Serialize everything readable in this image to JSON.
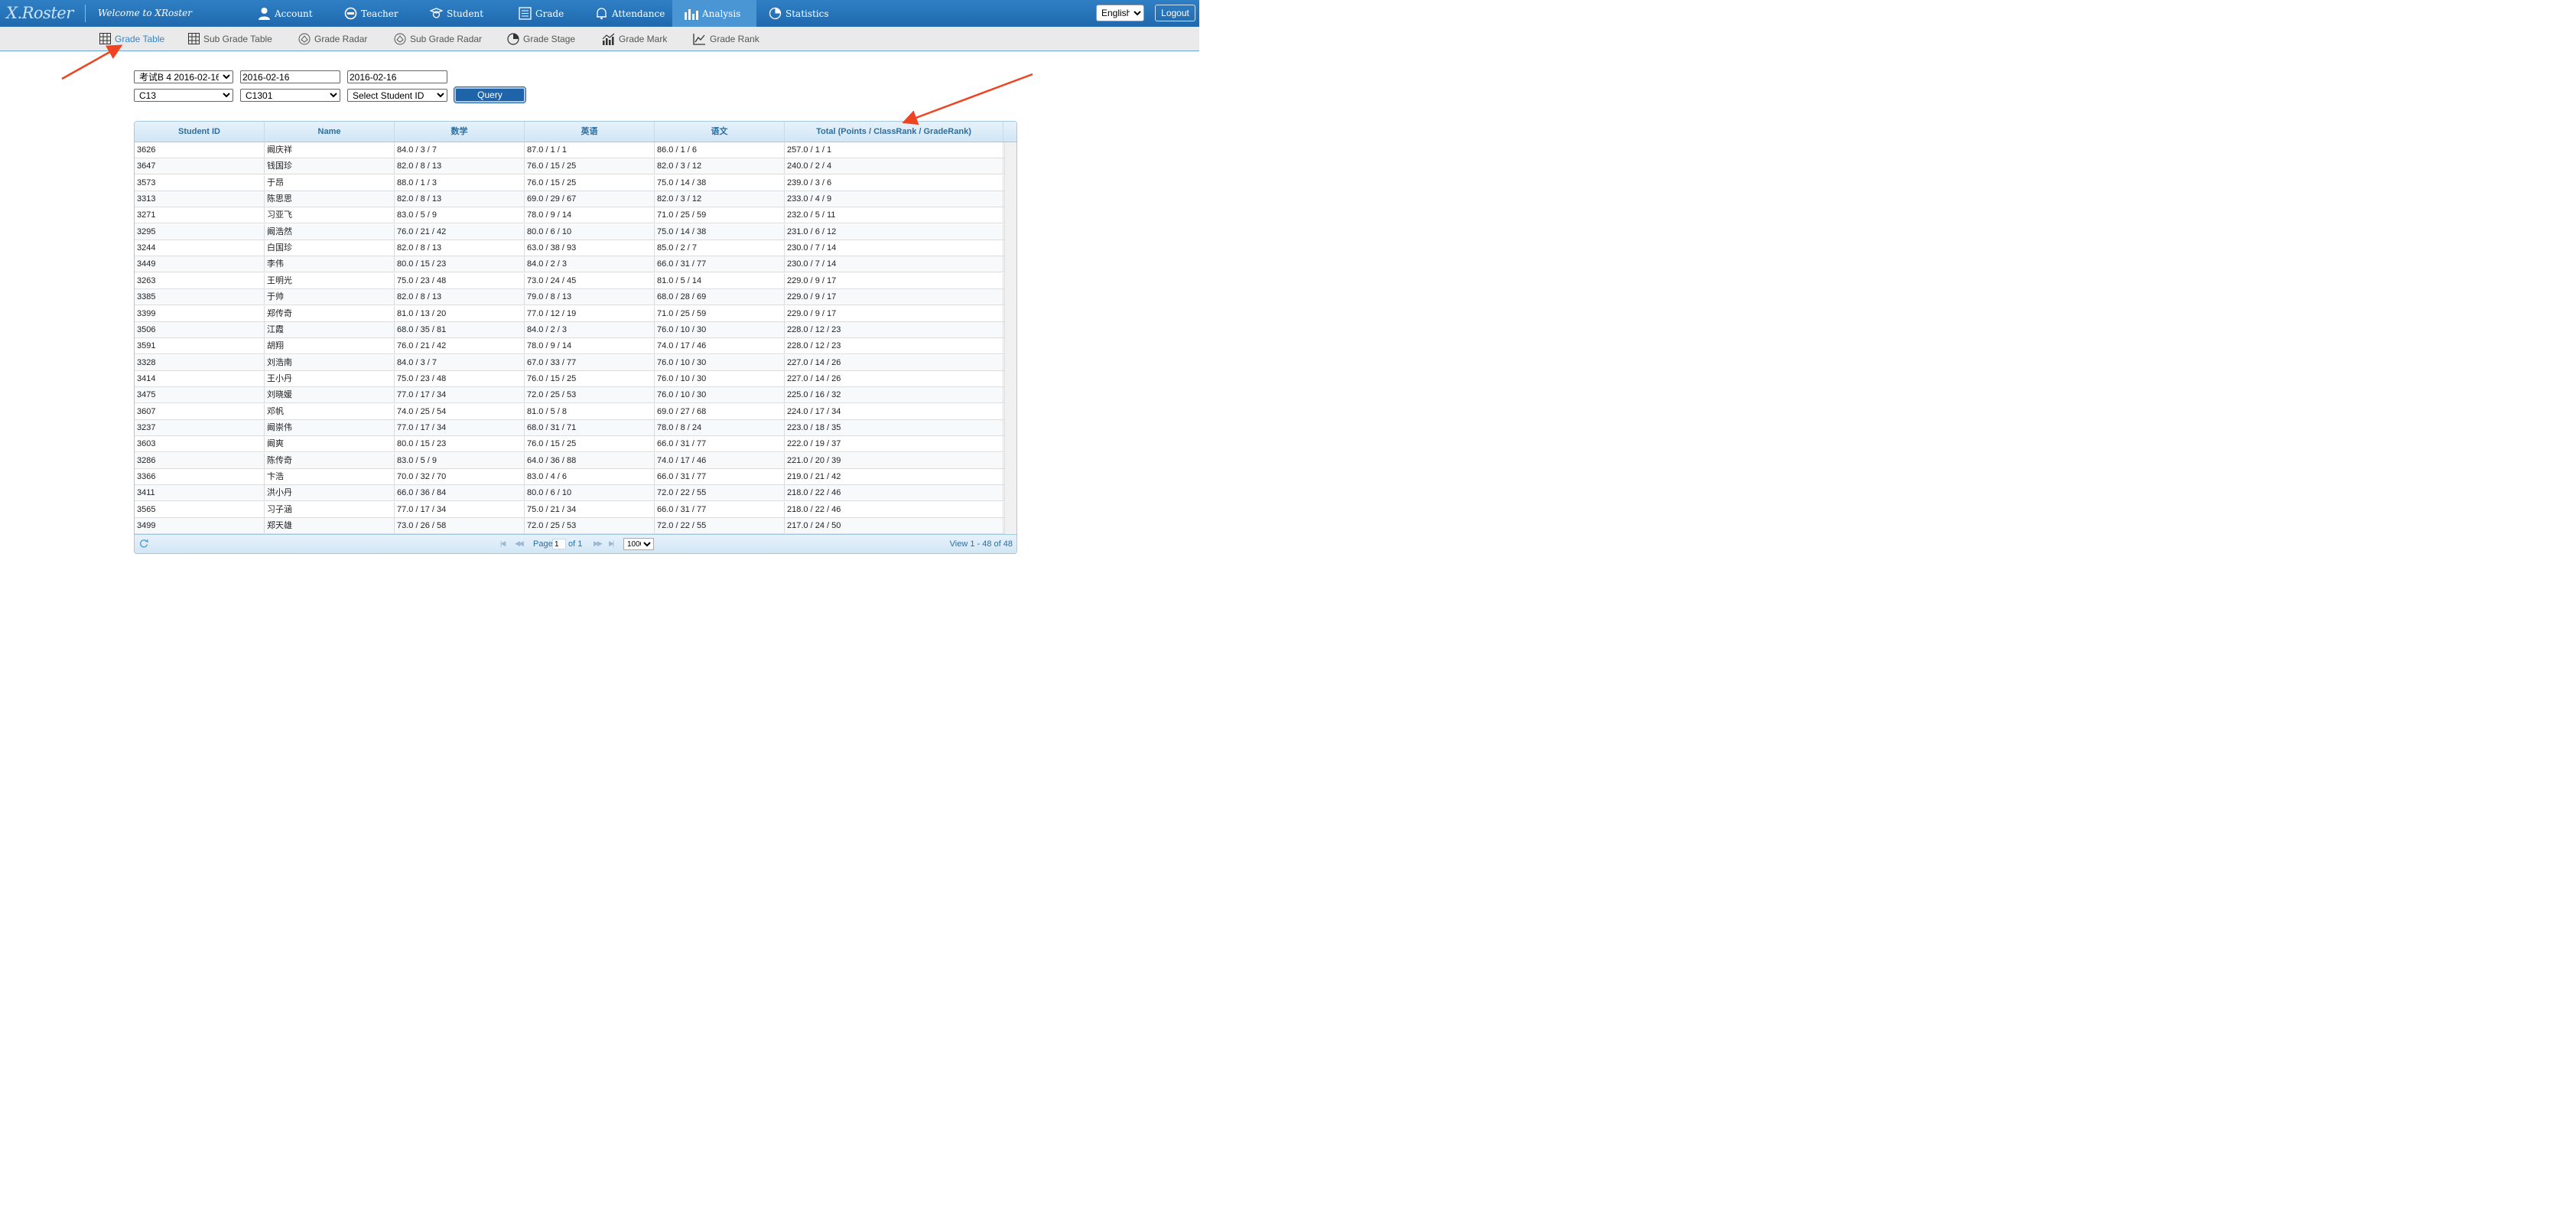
{
  "app": {
    "logo": "X.Roster",
    "welcome": "Welcome to XRoster",
    "nav": [
      {
        "label": "Account",
        "icon": "user-icon"
      },
      {
        "label": "Teacher",
        "icon": "teacher-icon"
      },
      {
        "label": "Student",
        "icon": "student-icon"
      },
      {
        "label": "Grade",
        "icon": "grade-list-icon"
      },
      {
        "label": "Attendance",
        "icon": "bell-icon"
      },
      {
        "label": "Analysis",
        "icon": "bar-chart-icon",
        "active": true
      },
      {
        "label": "Statistics",
        "icon": "pie-chart-icon"
      }
    ],
    "language": "English",
    "logout": "Logout"
  },
  "subnav": [
    {
      "label": "Grade Table",
      "icon": "table-icon",
      "active": true
    },
    {
      "label": "Sub Grade Table",
      "icon": "table-icon"
    },
    {
      "label": "Grade Radar",
      "icon": "radar-icon"
    },
    {
      "label": "Sub Grade Radar",
      "icon": "radar-icon"
    },
    {
      "label": "Grade Stage",
      "icon": "pie-chart-icon"
    },
    {
      "label": "Grade Mark",
      "icon": "bar-line-chart-icon"
    },
    {
      "label": "Grade Rank",
      "icon": "line-chart-icon"
    }
  ],
  "filters": {
    "exam": "考试B 4 2016-02-16",
    "start_date": "2016-02-16",
    "end_date": "2016-02-16",
    "grade": "C13",
    "class": "C1301",
    "student": "Select Student ID",
    "query": "Query"
  },
  "table": {
    "columns": [
      "Student ID",
      "Name",
      "数学",
      "英语",
      "语文",
      "Total (Points / ClassRank / GradeRank)"
    ],
    "rows": [
      [
        "3626",
        "阚庆祥",
        "84.0 / 3 / 7",
        "87.0 / 1 / 1",
        "86.0 / 1 / 6",
        "257.0 / 1 / 1"
      ],
      [
        "3647",
        "钱国珍",
        "82.0 / 8 / 13",
        "76.0 / 15 / 25",
        "82.0 / 3 / 12",
        "240.0 / 2 / 4"
      ],
      [
        "3573",
        "于昂",
        "88.0 / 1 / 3",
        "76.0 / 15 / 25",
        "75.0 / 14 / 38",
        "239.0 / 3 / 6"
      ],
      [
        "3313",
        "陈思思",
        "82.0 / 8 / 13",
        "69.0 / 29 / 67",
        "82.0 / 3 / 12",
        "233.0 / 4 / 9"
      ],
      [
        "3271",
        "习亚飞",
        "83.0 / 5 / 9",
        "78.0 / 9 / 14",
        "71.0 / 25 / 59",
        "232.0 / 5 / 11"
      ],
      [
        "3295",
        "阚浩然",
        "76.0 / 21 / 42",
        "80.0 / 6 / 10",
        "75.0 / 14 / 38",
        "231.0 / 6 / 12"
      ],
      [
        "3244",
        "白国珍",
        "82.0 / 8 / 13",
        "63.0 / 38 / 93",
        "85.0 / 2 / 7",
        "230.0 / 7 / 14"
      ],
      [
        "3449",
        "李伟",
        "80.0 / 15 / 23",
        "84.0 / 2 / 3",
        "66.0 / 31 / 77",
        "230.0 / 7 / 14"
      ],
      [
        "3263",
        "王明光",
        "75.0 / 23 / 48",
        "73.0 / 24 / 45",
        "81.0 / 5 / 14",
        "229.0 / 9 / 17"
      ],
      [
        "3385",
        "于帅",
        "82.0 / 8 / 13",
        "79.0 / 8 / 13",
        "68.0 / 28 / 69",
        "229.0 / 9 / 17"
      ],
      [
        "3399",
        "郑传奇",
        "81.0 / 13 / 20",
        "77.0 / 12 / 19",
        "71.0 / 25 / 59",
        "229.0 / 9 / 17"
      ],
      [
        "3506",
        "江霞",
        "68.0 / 35 / 81",
        "84.0 / 2 / 3",
        "76.0 / 10 / 30",
        "228.0 / 12 / 23"
      ],
      [
        "3591",
        "胡翔",
        "76.0 / 21 / 42",
        "78.0 / 9 / 14",
        "74.0 / 17 / 46",
        "228.0 / 12 / 23"
      ],
      [
        "3328",
        "刘浩南",
        "84.0 / 3 / 7",
        "67.0 / 33 / 77",
        "76.0 / 10 / 30",
        "227.0 / 14 / 26"
      ],
      [
        "3414",
        "王小丹",
        "75.0 / 23 / 48",
        "76.0 / 15 / 25",
        "76.0 / 10 / 30",
        "227.0 / 14 / 26"
      ],
      [
        "3475",
        "刘晓媛",
        "77.0 / 17 / 34",
        "72.0 / 25 / 53",
        "76.0 / 10 / 30",
        "225.0 / 16 / 32"
      ],
      [
        "3607",
        "邓帆",
        "74.0 / 25 / 54",
        "81.0 / 5 / 8",
        "69.0 / 27 / 68",
        "224.0 / 17 / 34"
      ],
      [
        "3237",
        "阚崇伟",
        "77.0 / 17 / 34",
        "68.0 / 31 / 71",
        "78.0 / 8 / 24",
        "223.0 / 18 / 35"
      ],
      [
        "3603",
        "阚爽",
        "80.0 / 15 / 23",
        "76.0 / 15 / 25",
        "66.0 / 31 / 77",
        "222.0 / 19 / 37"
      ],
      [
        "3286",
        "陈传奇",
        "83.0 / 5 / 9",
        "64.0 / 36 / 88",
        "74.0 / 17 / 46",
        "221.0 / 20 / 39"
      ],
      [
        "3366",
        "卞浩",
        "70.0 / 32 / 70",
        "83.0 / 4 / 6",
        "66.0 / 31 / 77",
        "219.0 / 21 / 42"
      ],
      [
        "3411",
        "洪小丹",
        "66.0 / 36 / 84",
        "80.0 / 6 / 10",
        "72.0 / 22 / 55",
        "218.0 / 22 / 46"
      ],
      [
        "3565",
        "习子涵",
        "77.0 / 17 / 34",
        "75.0 / 21 / 34",
        "66.0 / 31 / 77",
        "218.0 / 22 / 46"
      ],
      [
        "3499",
        "郑天雄",
        "73.0 / 26 / 58",
        "72.0 / 25 / 53",
        "72.0 / 22 / 55",
        "217.0 / 24 / 50"
      ]
    ]
  },
  "pager": {
    "page_label": "Page",
    "page": "1",
    "of_label": "of 1",
    "page_size": "1000",
    "view": "View 1 - 48 of 48"
  },
  "colors": {
    "nav": "#1f69ae",
    "active_nav": "#4a95d3",
    "subnav_active": "#2f88d0",
    "arrow": "#ee4422"
  }
}
